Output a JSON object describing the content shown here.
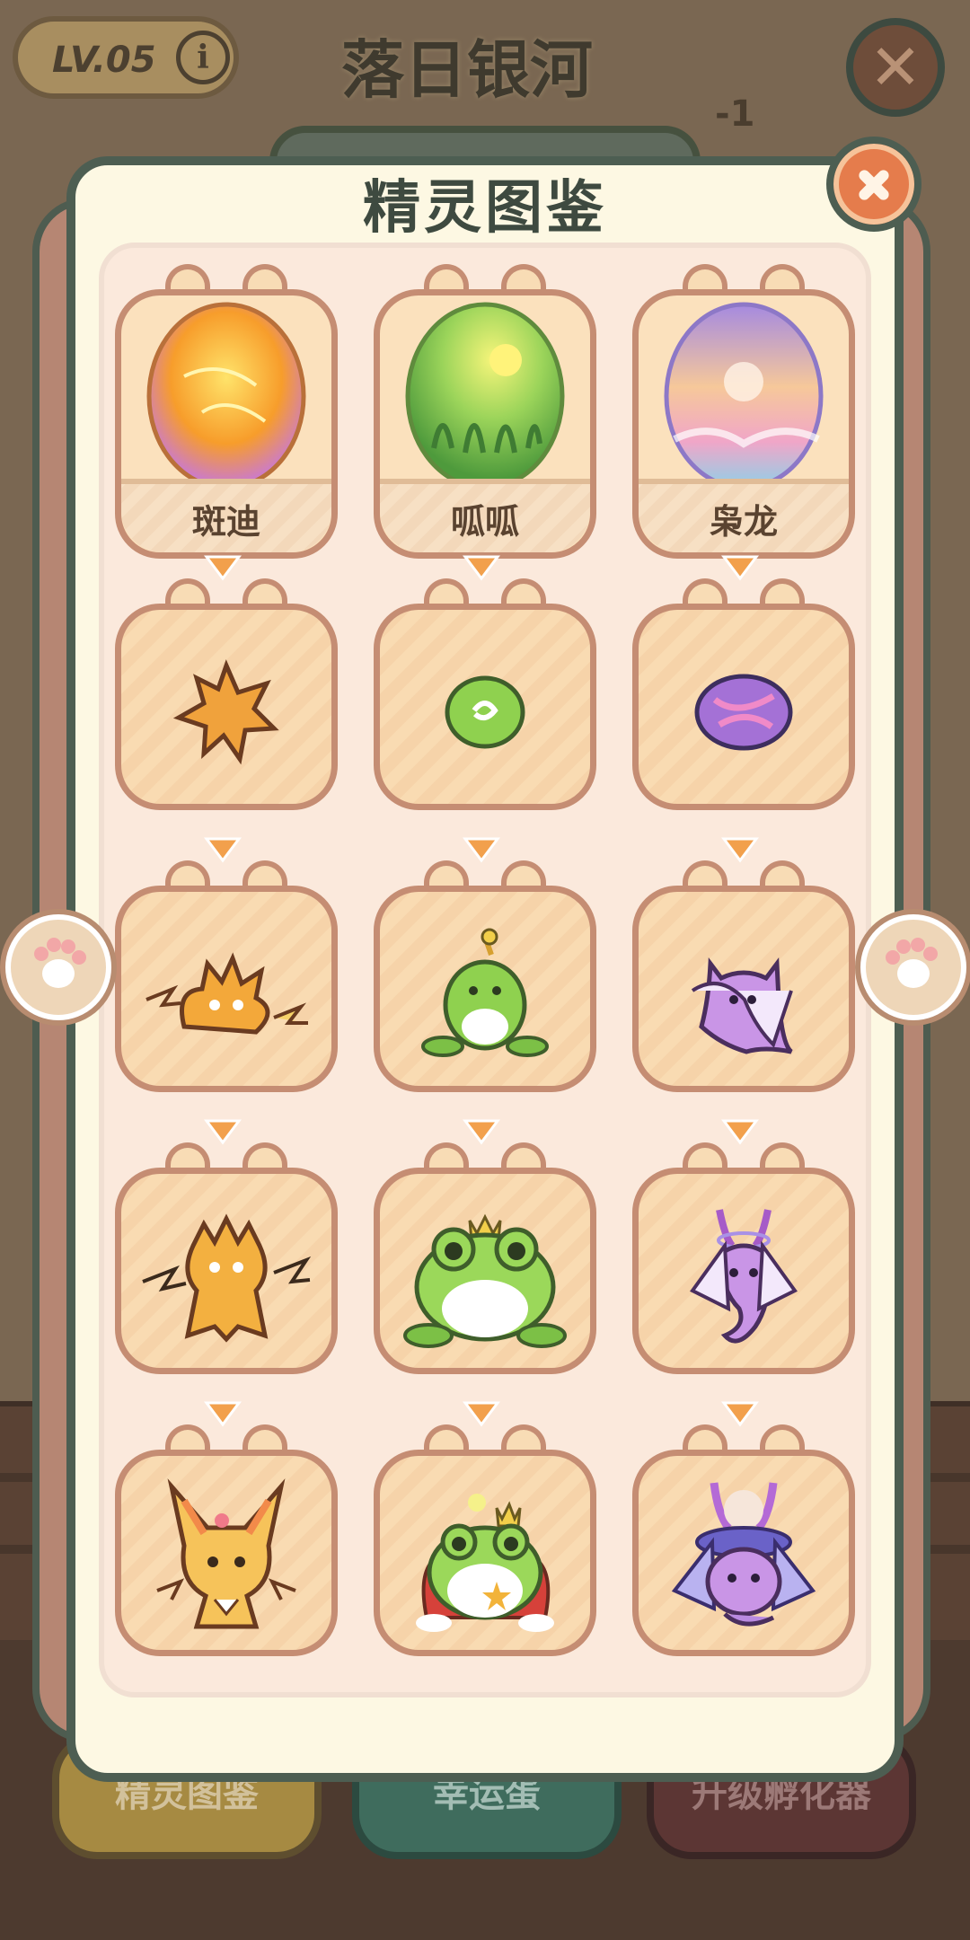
{
  "background": {
    "level_label": "LV.05",
    "stage_title": "落日银河",
    "counter": "-1",
    "buttons": {
      "dex": "精灵图鉴",
      "lucky": "幸运蛋",
      "upgrade": "升级孵化器"
    }
  },
  "modal": {
    "title": "精灵图鉴",
    "columns": [
      {
        "egg_name": "斑迪",
        "egg_color": "#f6a43a",
        "stages": [
          "spiky-seed",
          "flame-cub",
          "thunder-fox",
          "golden-lynx"
        ]
      },
      {
        "egg_name": "呱呱",
        "egg_color": "#8ecf5a",
        "stages": [
          "green-seed",
          "sprout-frog",
          "crown-frog",
          "king-frog"
        ]
      },
      {
        "egg_name": "枭龙",
        "egg_color": "#b7a1e6",
        "stages": [
          "purple-seed",
          "ghost-imp",
          "horned-spirit",
          "galaxy-dragon"
        ]
      }
    ]
  },
  "colors": {
    "accent": "#e57c4c",
    "card": "#f8dcb5",
    "border": "#c58d73",
    "panel": "#fdf8e3"
  }
}
